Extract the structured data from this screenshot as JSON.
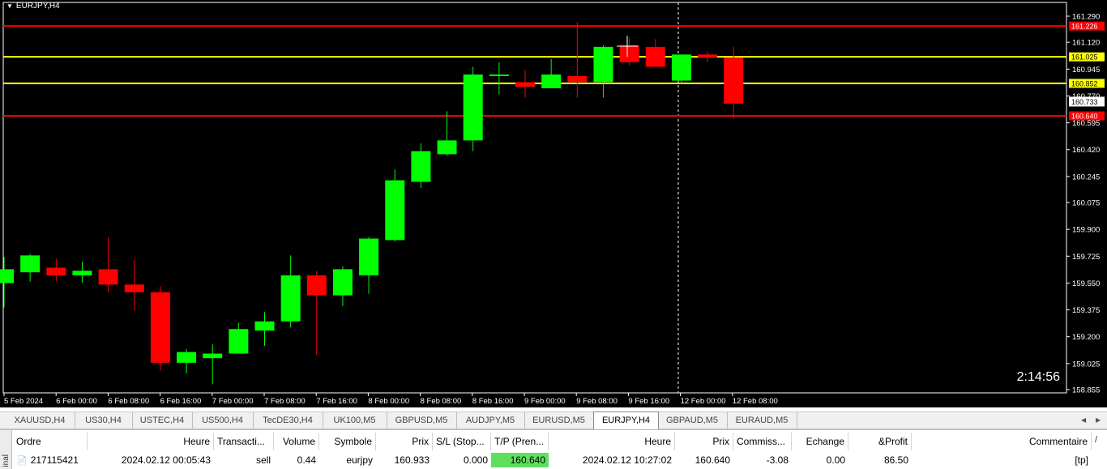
{
  "chart": {
    "symbol": "EURJPY,H4",
    "countdown": "2:14:56",
    "colors": {
      "bull": "#00ff00",
      "bear": "#ff0000",
      "red_line": "#ff0000",
      "yellow_line": "#ffff00",
      "background": "#000000",
      "axis": "#ffffff"
    },
    "price_axis": {
      "ticks": [
        "161.290",
        "161.120",
        "160.945",
        "160.770",
        "160.595",
        "160.420",
        "160.245",
        "160.075",
        "159.900",
        "159.725",
        "159.550",
        "159.375",
        "159.200",
        "159.025",
        "158.855"
      ],
      "tick_values": [
        161.29,
        161.12,
        160.945,
        160.77,
        160.595,
        160.42,
        160.245,
        160.075,
        159.9,
        159.725,
        159.55,
        159.375,
        159.2,
        159.025,
        158.855
      ]
    },
    "time_axis": [
      "5 Feb 2024",
      "6 Feb 00:00",
      "6 Feb 08:00",
      "6 Feb 16:00",
      "7 Feb 00:00",
      "7 Feb 08:00",
      "7 Feb 16:00",
      "8 Feb 00:00",
      "8 Feb 08:00",
      "8 Feb 16:00",
      "9 Feb 00:00",
      "9 Feb 08:00",
      "9 Feb 16:00",
      "12 Feb 00:00",
      "12 Feb 08:00"
    ],
    "horizontal_lines": [
      {
        "label": "161.226",
        "value": 161.226,
        "color": "#ff0000"
      },
      {
        "label": "161.025",
        "value": 161.025,
        "color": "#ffff00"
      },
      {
        "label": "160.852",
        "value": 160.852,
        "color": "#ffff00"
      },
      {
        "label": "160.640",
        "value": 160.64,
        "color": "#ff0000"
      }
    ],
    "current_price": {
      "label": "160.733",
      "value": 160.733
    },
    "candles": [
      {
        "o": 159.55,
        "h": 159.72,
        "l": 159.39,
        "c": 159.64
      },
      {
        "o": 159.62,
        "h": 159.74,
        "l": 159.56,
        "c": 159.73
      },
      {
        "o": 159.65,
        "h": 159.71,
        "l": 159.56,
        "c": 159.6
      },
      {
        "o": 159.6,
        "h": 159.69,
        "l": 159.55,
        "c": 159.63
      },
      {
        "o": 159.64,
        "h": 159.85,
        "l": 159.49,
        "c": 159.54
      },
      {
        "o": 159.54,
        "h": 159.7,
        "l": 159.37,
        "c": 159.49
      },
      {
        "o": 159.49,
        "h": 159.53,
        "l": 158.98,
        "c": 159.03
      },
      {
        "o": 159.03,
        "h": 159.12,
        "l": 158.96,
        "c": 159.1
      },
      {
        "o": 159.06,
        "h": 159.15,
        "l": 158.89,
        "c": 159.09
      },
      {
        "o": 159.09,
        "h": 159.29,
        "l": 159.09,
        "c": 159.25
      },
      {
        "o": 159.24,
        "h": 159.36,
        "l": 159.14,
        "c": 159.3
      },
      {
        "o": 159.3,
        "h": 159.73,
        "l": 159.26,
        "c": 159.6
      },
      {
        "o": 159.6,
        "h": 159.63,
        "l": 159.08,
        "c": 159.47
      },
      {
        "o": 159.47,
        "h": 159.66,
        "l": 159.4,
        "c": 159.64
      },
      {
        "o": 159.6,
        "h": 159.85,
        "l": 159.48,
        "c": 159.84
      },
      {
        "o": 159.83,
        "h": 160.29,
        "l": 159.82,
        "c": 160.22
      },
      {
        "o": 160.21,
        "h": 160.46,
        "l": 160.17,
        "c": 160.41
      },
      {
        "o": 160.39,
        "h": 160.67,
        "l": 160.38,
        "c": 160.48
      },
      {
        "o": 160.48,
        "h": 160.96,
        "l": 160.41,
        "c": 160.91
      },
      {
        "o": 160.9,
        "h": 160.99,
        "l": 160.78,
        "c": 160.91
      },
      {
        "o": 160.86,
        "h": 160.94,
        "l": 160.76,
        "c": 160.83
      },
      {
        "o": 160.82,
        "h": 161.01,
        "l": 160.82,
        "c": 160.91
      },
      {
        "o": 160.9,
        "h": 161.25,
        "l": 160.76,
        "c": 160.86
      },
      {
        "o": 160.86,
        "h": 161.1,
        "l": 160.76,
        "c": 161.09
      },
      {
        "o": 161.1,
        "h": 161.15,
        "l": 160.97,
        "c": 160.99
      },
      {
        "o": 161.09,
        "h": 161.14,
        "l": 160.96,
        "c": 160.96
      },
      {
        "o": 160.87,
        "h": 161.04,
        "l": 160.85,
        "c": 161.04
      },
      {
        "o": 161.04,
        "h": 161.06,
        "l": 160.99,
        "c": 161.02
      },
      {
        "o": 161.02,
        "h": 161.09,
        "l": 160.62,
        "c": 160.72
      }
    ]
  },
  "tabs": {
    "items": [
      "XAUUSD,H4",
      "US30,H4",
      "USTEC,H4",
      "US500,H4",
      "TecDE30,H4",
      "UK100,M5",
      "GBPUSD,M5",
      "AUDJPY,M5",
      "EURUSD,M5",
      "EURJPY,H4",
      "GBPAUD,M5",
      "EURAUD,M5"
    ],
    "active": "EURJPY,H4"
  },
  "terminal": {
    "side_label": "inal",
    "headers": [
      "Ordre",
      "Heure",
      "Transacti...",
      "Volume",
      "Symbole",
      "Prix",
      "S/L (Stop...",
      "T/P (Pren...",
      "Heure",
      "Prix",
      "Commiss...",
      "Echange",
      "&Profit",
      "Commentaire"
    ],
    "rows": [
      [
        "217115421",
        "2024.02.12 00:05:43",
        "sell",
        "0.44",
        "eurjpy",
        "160.933",
        "0.000",
        "160.640",
        "2024.02.12 10:27:02",
        "160.640",
        "-3.08",
        "0.00",
        "86.50",
        "[tp]"
      ]
    ],
    "tp_highlight": "#5ee05e"
  }
}
